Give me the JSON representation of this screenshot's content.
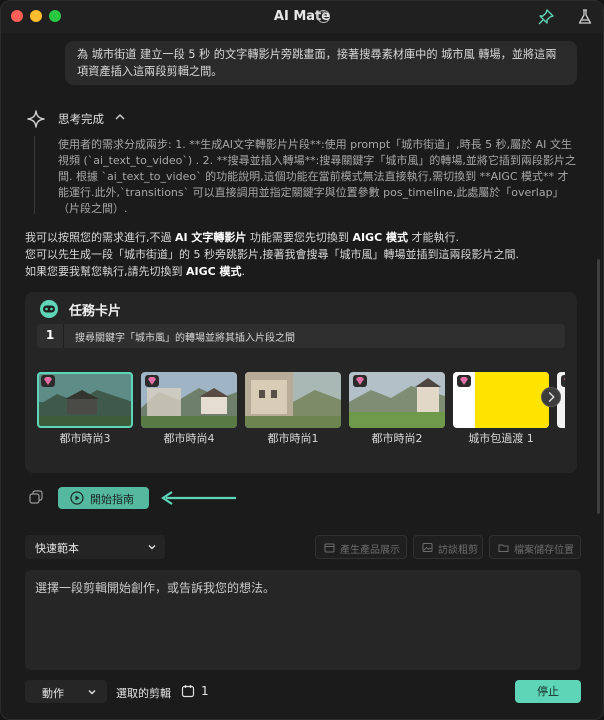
{
  "window": {
    "title": "AI Mate"
  },
  "colors": {
    "accent": "#5fd5b7",
    "background": "#1b1b1b",
    "card": "#252525",
    "gem": "#e36fa6"
  },
  "user_message": {
    "text": "為 城市街道 建立一段 5 秒 的文字轉影片旁跳畫面，接著搜尋素材庫中的 城市風 轉場，並將這兩項資產插入這兩段剪輯之間。"
  },
  "thinking": {
    "title": "思考完成",
    "body": "使用者的需求分成兩步: 1. **生成AI文字轉影片片段**:使用 prompt「城市街道」,時長 5 秒,屬於 AI 文生視頻 (`ai_text_to_video`) . 2. **搜尋並插入轉場**:搜尋關鍵字「城市風」的轉場,並將它插到兩段影片之間. 根據 `ai_text_to_video` 的功能說明,這個功能在當前模式無法直接執行,需切換到 **AIGC 模式** 才能運行.此外,`transitions` 可以直接調用並指定關鍵字與位置參數 pos_timeline,此處屬於「overlap」（片段之間）."
  },
  "answer": {
    "line1_a": "我可以按照您的需求進行,不過 ",
    "line1_b": "AI 文字轉影片",
    "line1_c": " 功能需要您先切換到 ",
    "line1_d": "AIGC 模式",
    "line1_e": " 才能執行.",
    "line2": "您可以先生成一段「城市街道」的 5 秒旁跳影片,接著我會搜尋「城市風」轉場並插到這兩段影片之間.",
    "line3_a": "如果您要我幫您執行,請先切換到 ",
    "line3_b": "AIGC 模式",
    "line3_c": "."
  },
  "task_card": {
    "title": "任務卡片",
    "step_number": "1",
    "step_text": "搜尋關鍵字「城市風」的轉場並將其插入片段之間",
    "thumbnails": [
      {
        "label": "都市時尚3",
        "selected": true
      },
      {
        "label": "都市時尚4",
        "selected": false
      },
      {
        "label": "都市時尚1",
        "selected": false
      },
      {
        "label": "都市時尚2",
        "selected": false
      },
      {
        "label": "城市包過渡 1",
        "selected": false
      }
    ]
  },
  "guide_button": {
    "label": "開始指南"
  },
  "templates": {
    "dropdown_label": "快速範本",
    "chips": [
      "產生產品展示",
      "訪談粗剪",
      "檔案儲存位置"
    ]
  },
  "prompt_input": {
    "placeholder": "選擇一段剪輯開始創作，或告訴我您的想法。"
  },
  "bottom_bar": {
    "action_label": "動作",
    "selected_label": "選取的剪輯",
    "selected_count": "1",
    "stop_label": "停止"
  }
}
